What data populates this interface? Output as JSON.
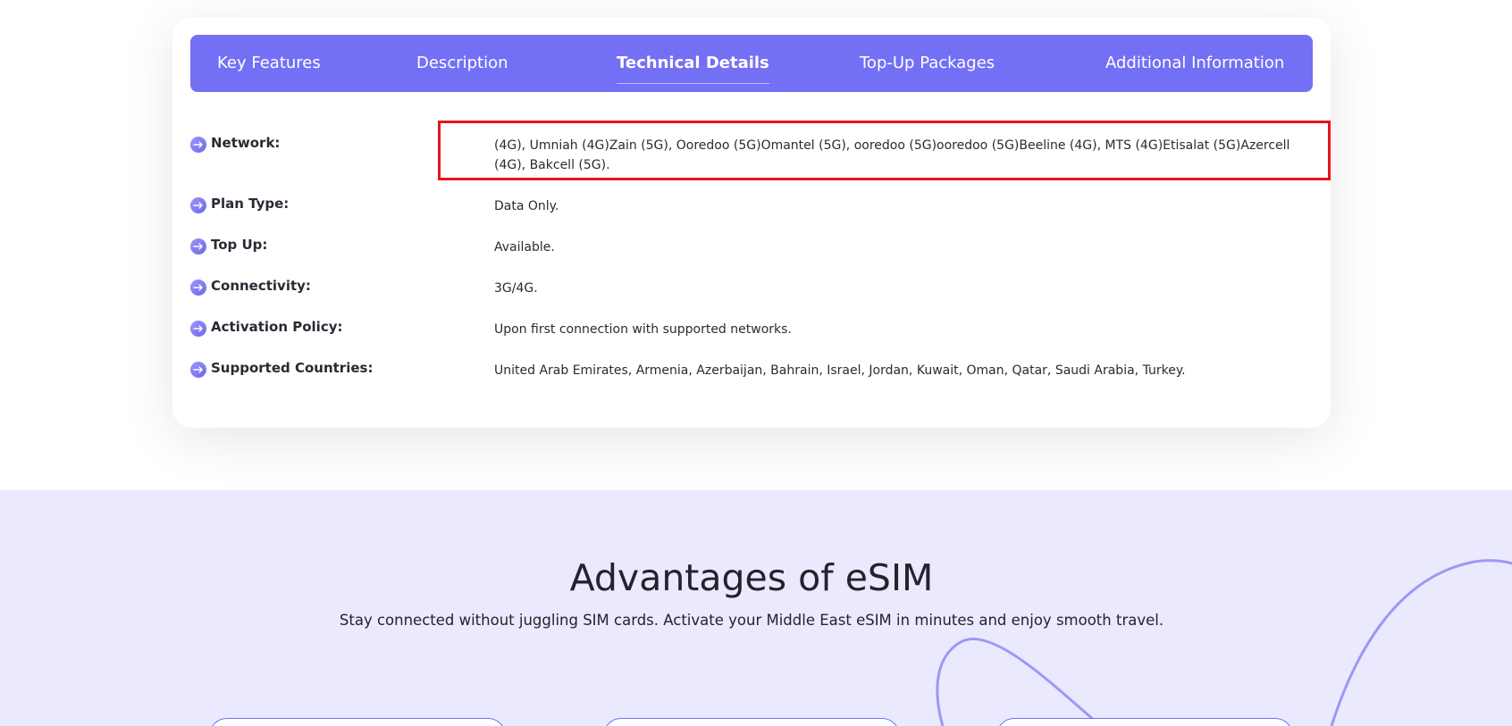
{
  "tabs": [
    {
      "label": "Key Features",
      "active": false
    },
    {
      "label": "Description",
      "active": false
    },
    {
      "label": "Technical Details",
      "active": true
    },
    {
      "label": "Top-Up Packages",
      "active": false
    },
    {
      "label": "Additional Information",
      "active": false
    }
  ],
  "details": [
    {
      "label": "Network:",
      "value": "(4G), Umniah (4G)Zain (5G), Ooredoo (5G)Omantel (5G), ooredoo (5G)ooredoo (5G)Beeline (4G), MTS (4G)Etisalat (5G)Azercell (4G), Bakcell (5G)."
    },
    {
      "label": "Plan Type:",
      "value": "Data Only."
    },
    {
      "label": "Top Up:",
      "value": "Available."
    },
    {
      "label": "Connectivity:",
      "value": "3G/4G."
    },
    {
      "label": "Activation Policy:",
      "value": "Upon first connection with supported networks."
    },
    {
      "label": "Supported Countries:",
      "value": "United Arab Emirates, Armenia, Azerbaijan, Bahrain, Israel, Jordan, Kuwait, Oman, Qatar, Saudi Arabia, Turkey."
    }
  ],
  "advantages": {
    "title": "Advantages of eSIM",
    "subtitle": "Stay connected without juggling SIM cards. Activate your Middle East eSIM in minutes and enjoy smooth travel."
  },
  "colors": {
    "accent": "#7470f5",
    "highlight": "#e5141a",
    "section_bg": "#ebe9fd"
  },
  "icons": {
    "row_bullet": "arrow-right-circle-icon"
  }
}
